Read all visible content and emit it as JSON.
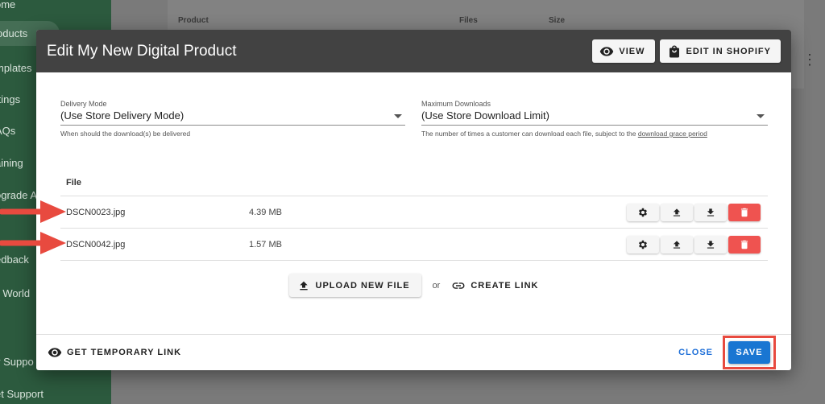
{
  "sidebar": {
    "items": [
      "ome",
      "oducts",
      "mplates",
      "ttings",
      "AQs",
      "aining",
      "ograde A",
      "edback",
      "ll World",
      "y Suppo",
      "et Support"
    ]
  },
  "background": {
    "columns": [
      "Product",
      "Files",
      "Size"
    ]
  },
  "modal": {
    "title": "Edit My New Digital Product",
    "view_label": "VIEW",
    "edit_shopify_label": "EDIT IN SHOPIFY",
    "delivery": {
      "label": "Delivery Mode",
      "value": "(Use Store Delivery Mode)",
      "hint": "When should the download(s) be delivered"
    },
    "downloads": {
      "label": "Maximum Downloads",
      "value": "(Use Store Download Limit)",
      "hint_prefix": "The number of times a customer can download each file, subject to the ",
      "hint_link": "download grace period"
    },
    "table": {
      "header": "File",
      "rows": [
        {
          "name": "DSCN0023.jpg",
          "size": "4.39 MB"
        },
        {
          "name": "DSCN0042.jpg",
          "size": "1.57 MB"
        }
      ]
    },
    "upload_label": "UPLOAD NEW FILE",
    "or_text": "or",
    "create_link_label": "CREATE LINK",
    "temp_link_label": "GET TEMPORARY LINK",
    "close_label": "CLOSE",
    "save_label": "SAVE"
  },
  "colors": {
    "header_bg": "#424242",
    "save_blue": "#1976d2",
    "delete_red": "#ef5350",
    "highlight_red": "#e84a3f",
    "sidebar_green": "#2c5a3e"
  },
  "icons": {
    "view": "eye-icon",
    "shopify": "shopping-bag-icon",
    "settings": "gear-icon",
    "upload": "upload-icon",
    "download": "download-icon",
    "delete": "trash-icon",
    "link": "link-icon",
    "temp_link": "eye-icon"
  }
}
